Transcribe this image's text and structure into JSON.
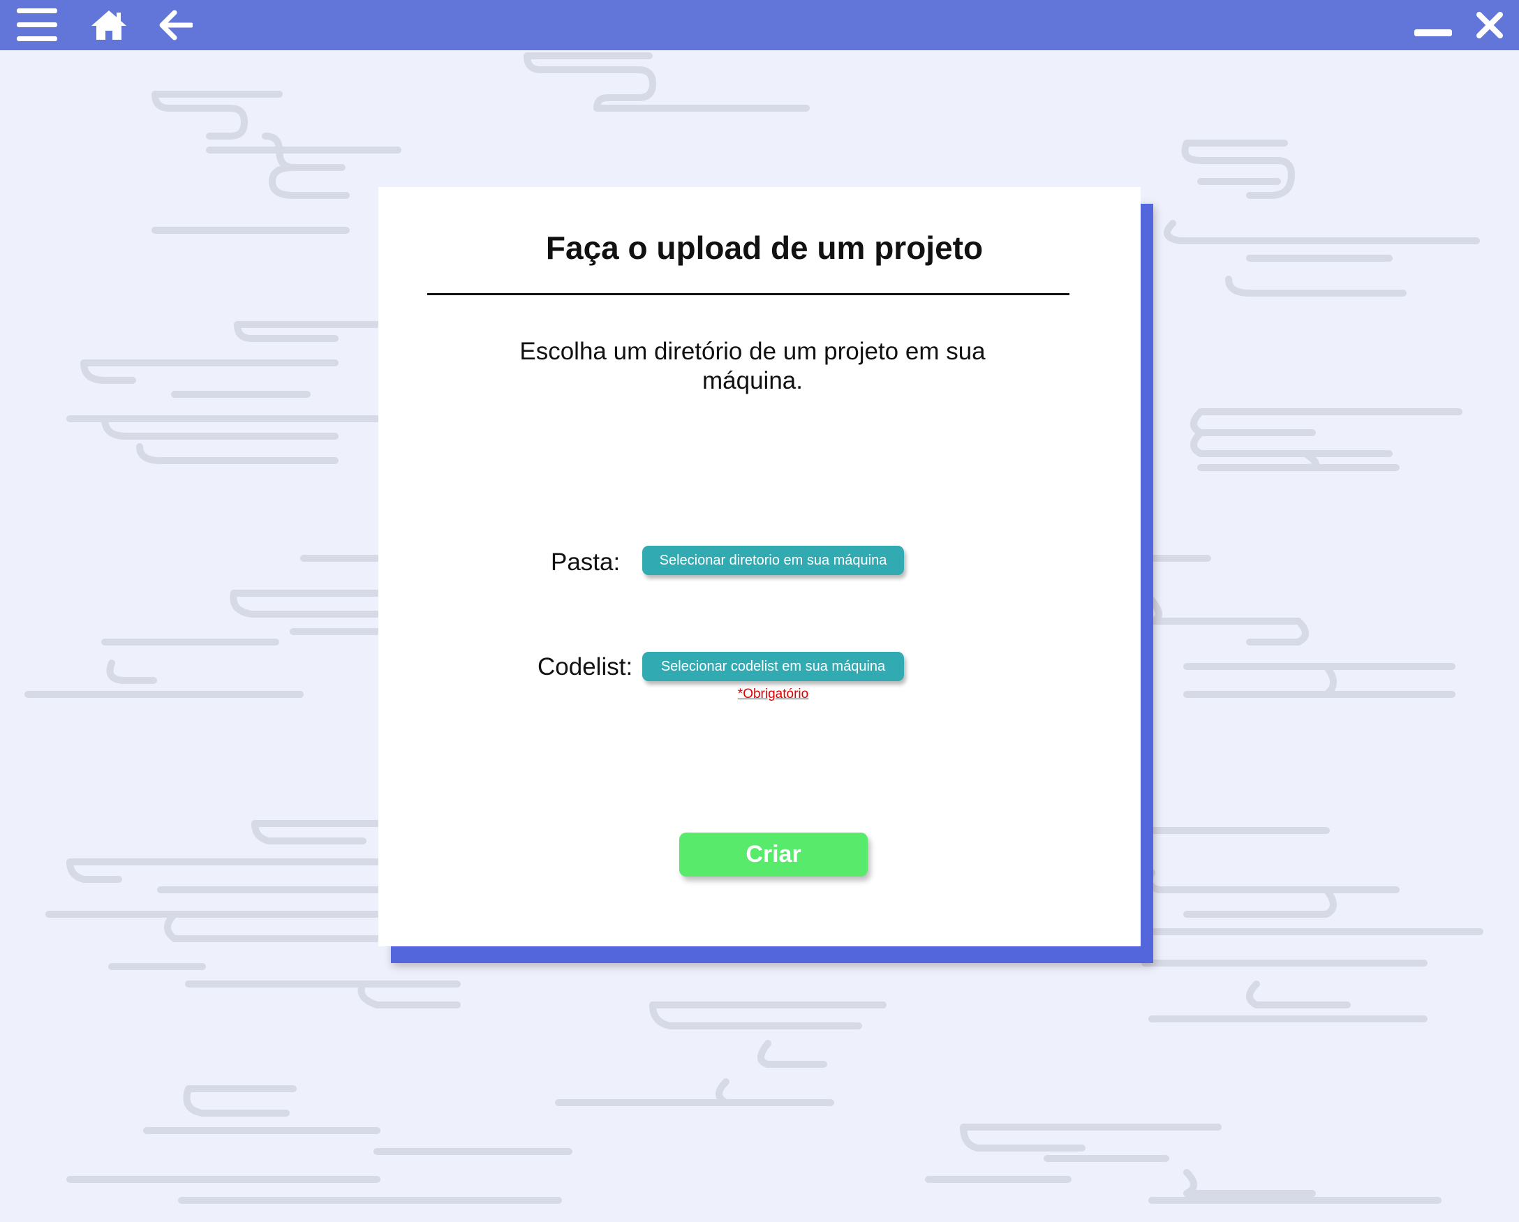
{
  "toolbar": {
    "menu_icon": "hamburger-menu-icon",
    "home_icon": "home-icon",
    "back_icon": "arrow-left-icon",
    "minimize_icon": "minimize-icon",
    "close_icon": "close-icon",
    "bar_color": "#6275d8"
  },
  "dialog": {
    "title": "Faça o upload de um projeto",
    "subtitle": "Escolha um diretório de um projeto em sua máquina.",
    "pasta_label": "Pasta:",
    "pasta_button": "Selecionar diretorio em sua máquina",
    "codelist_label": "Codelist:",
    "codelist_button": "Selecionar codelist em sua máquina",
    "required_note": "*Obrigatório",
    "create_button": "Criar"
  },
  "colors": {
    "accent": "#5466dc",
    "select_button": "#32aab2",
    "create_button": "#57ea6b",
    "required": "#e00000",
    "background": "#eef1fb"
  }
}
